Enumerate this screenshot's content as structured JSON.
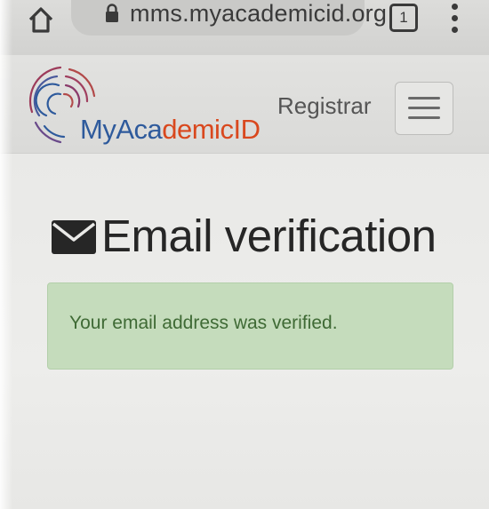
{
  "browser": {
    "url": "mms.myacademicid.org",
    "tab_count": "1",
    "home_icon": "home-icon",
    "lock_icon": "lock-icon",
    "menu_icon": "vertical-dots-icon"
  },
  "header": {
    "logo_my": "MyAca",
    "logo_demic": "demic",
    "logo_id": "ID",
    "nav_label": "Registrar",
    "menu_toggle_icon": "hamburger-icon"
  },
  "main": {
    "title_icon": "envelope-icon",
    "title": "Email verification",
    "alert_message": "Your email address was verified."
  },
  "colors": {
    "brand_blue": "#2e5a9c",
    "brand_orange": "#d9481e",
    "alert_bg": "#c5dcbc",
    "alert_text": "#3f6a35"
  }
}
